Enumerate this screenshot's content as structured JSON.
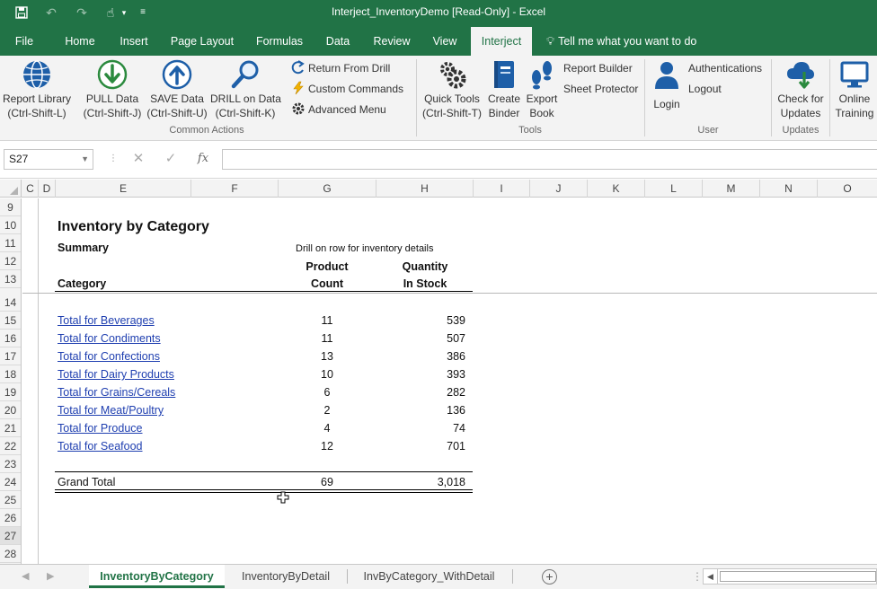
{
  "title": "Interject_InventoryDemo  [Read-Only]  -  Excel",
  "colors": {
    "accent": "#217346",
    "link": "#1f3fb0"
  },
  "ribbon_tabs": [
    "File",
    "Home",
    "Insert",
    "Page Layout",
    "Formulas",
    "Data",
    "Review",
    "View",
    "Interject"
  ],
  "active_tab": "Interject",
  "tell_me": "Tell me what you want to do",
  "ribbon": {
    "report_library": {
      "line1": "Report Library",
      "line2": "(Ctrl-Shift-L)"
    },
    "pull": {
      "line1": "PULL Data",
      "line2": "(Ctrl-Shift-J)"
    },
    "save": {
      "line1": "SAVE Data",
      "line2": "(Ctrl-Shift-U)"
    },
    "drill": {
      "line1": "DRILL on Data",
      "line2": "(Ctrl-Shift-K)"
    },
    "return_from_drill": "Return From Drill",
    "custom_commands": "Custom Commands",
    "advanced_menu": "Advanced Menu",
    "common_actions_label": "Common Actions",
    "quick_tools": {
      "line1": "Quick Tools",
      "line2": "(Ctrl-Shift-T)"
    },
    "create_binder": {
      "line1": "Create",
      "line2": "Binder"
    },
    "export_book": {
      "line1": "Export",
      "line2": "Book"
    },
    "report_builder": "Report Builder",
    "sheet_protector": "Sheet Protector",
    "tools_label": "Tools",
    "login": "Login",
    "authentications": "Authentications",
    "logout": "Logout",
    "user_label": "User",
    "check_updates": {
      "line1": "Check for",
      "line2": "Updates"
    },
    "updates_label": "Updates",
    "online_training": {
      "line1": "Online",
      "line2": "Training"
    }
  },
  "namebox": "S27",
  "fx": "fx",
  "columns": [
    "C",
    "D",
    "E",
    "F",
    "G",
    "H",
    "I",
    "J",
    "K",
    "L",
    "M",
    "N",
    "O"
  ],
  "rows": [
    "9",
    "10",
    "11",
    "12",
    "13",
    "14",
    "15",
    "16",
    "17",
    "18",
    "19",
    "20",
    "21",
    "22",
    "23",
    "24",
    "25",
    "26",
    "27",
    "28"
  ],
  "report": {
    "title": "Inventory by Category",
    "subtitle": "Summary",
    "drill_note": "Drill on row for inventory details",
    "header_category": "Category",
    "header_count_1": "Product",
    "header_count_2": "Count",
    "header_qty_1": "Quantity",
    "header_qty_2": "In Stock",
    "rows": [
      {
        "category": "Total for Beverages",
        "count": "11",
        "qty": "539"
      },
      {
        "category": "Total for Condiments",
        "count": "11",
        "qty": "507"
      },
      {
        "category": "Total for Confections",
        "count": "13",
        "qty": "386"
      },
      {
        "category": "Total for Dairy Products",
        "count": "10",
        "qty": "393"
      },
      {
        "category": "Total for Grains/Cereals",
        "count": "6",
        "qty": "282"
      },
      {
        "category": "Total for Meat/Poultry",
        "count": "2",
        "qty": "136"
      },
      {
        "category": "Total for Produce",
        "count": "4",
        "qty": "74"
      },
      {
        "category": "Total for Seafood",
        "count": "12",
        "qty": "701"
      }
    ],
    "grand_total_label": "Grand Total",
    "grand_total_count": "69",
    "grand_total_qty": "3,018"
  },
  "sheet_tabs": [
    "InventoryByCategory",
    "InventoryByDetail",
    "InvByCategory_WithDetail"
  ],
  "active_sheet": "InventoryByCategory"
}
